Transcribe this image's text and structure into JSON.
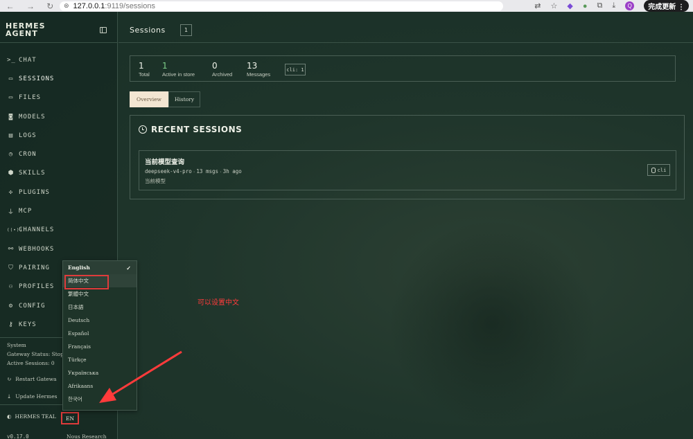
{
  "browser": {
    "url_host": "127.0.0.1",
    "url_path": ":9119/sessions",
    "profile_initial": "Q",
    "update_label": "完成更新"
  },
  "sidebar": {
    "brand_line1": "HERMES",
    "brand_line2": "AGENT",
    "items": [
      {
        "label": "CHAT",
        "icon": "terminal-icon",
        "glyph": ">_"
      },
      {
        "label": "SESSIONS",
        "icon": "message-square-icon",
        "glyph": "▭"
      },
      {
        "label": "FILES",
        "icon": "folder-icon",
        "glyph": "▭"
      },
      {
        "label": "MODELS",
        "icon": "cpu-icon",
        "glyph": "◙"
      },
      {
        "label": "LOGS",
        "icon": "file-text-icon",
        "glyph": "▤"
      },
      {
        "label": "CRON",
        "icon": "clock-icon",
        "glyph": "◷"
      },
      {
        "label": "SKILLS",
        "icon": "package-icon",
        "glyph": "⬢"
      },
      {
        "label": "PLUGINS",
        "icon": "puzzle-icon",
        "glyph": "✣"
      },
      {
        "label": "MCP",
        "icon": "plug-icon",
        "glyph": "⏚"
      },
      {
        "label": "CHANNELS",
        "icon": "radio-icon",
        "glyph": "((•))"
      },
      {
        "label": "WEBHOOKS",
        "icon": "webhook-icon",
        "glyph": "⚯"
      },
      {
        "label": "PAIRING",
        "icon": "shield-icon",
        "glyph": "⛉"
      },
      {
        "label": "PROFILES",
        "icon": "users-icon",
        "glyph": "⚇"
      },
      {
        "label": "CONFIG",
        "icon": "settings-icon",
        "glyph": "⚙"
      },
      {
        "label": "KEYS",
        "icon": "key-icon",
        "glyph": "⚷"
      }
    ],
    "system_label": "System",
    "gateway_status": "Gateway Status: Stop",
    "active_sessions": "Active Sessions: 0",
    "restart_label": "Restart Gatewa",
    "update_label": "Update Hermes",
    "theme_label": "HERMES TEAL",
    "lang_button": "EN",
    "version": "v0.17.0",
    "credit": "Nous Research"
  },
  "language_menu": {
    "options": [
      {
        "label": "English",
        "selected": true
      },
      {
        "label": "简体中文",
        "selected": false
      },
      {
        "label": "繁體中文",
        "selected": false
      },
      {
        "label": "日本語",
        "selected": false
      },
      {
        "label": "Deutsch",
        "selected": false
      },
      {
        "label": "Español",
        "selected": false
      },
      {
        "label": "Français",
        "selected": false
      },
      {
        "label": "Türkçe",
        "selected": false
      },
      {
        "label": "Українська",
        "selected": false
      },
      {
        "label": "Afrikaans",
        "selected": false
      },
      {
        "label": "한국어",
        "selected": false
      }
    ]
  },
  "header": {
    "title": "Sessions",
    "count": "1"
  },
  "stats": {
    "total_value": "1",
    "total_label": "Total",
    "active_value": "1",
    "active_label": "Active in store",
    "archived_value": "0",
    "archived_label": "Archived",
    "messages_value": "13",
    "messages_label": "Messages",
    "source_badge": "cli: 1"
  },
  "tabs": {
    "overview": "Overview",
    "history": "History"
  },
  "recent": {
    "title": "RECENT SESSIONS",
    "session": {
      "title": "当前模型查询",
      "model": "deepseek-v4-pro",
      "msgs": "13 msgs",
      "time": "3h ago",
      "preview": "当前模型",
      "source": "cli"
    }
  },
  "annotation": {
    "text": "可以设置中文",
    "color": "#ff3b3b"
  }
}
